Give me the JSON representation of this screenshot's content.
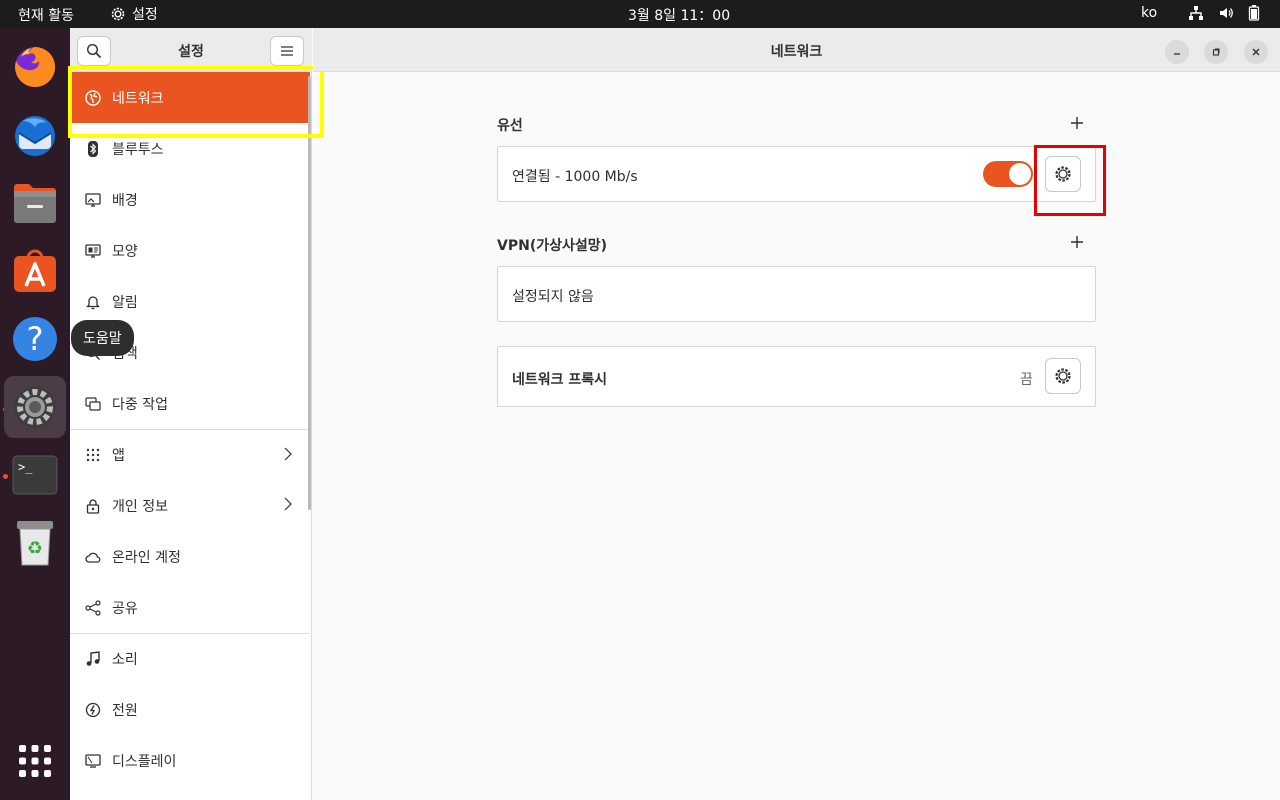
{
  "topbar": {
    "activities": "현재 활동",
    "app_name": "설정",
    "clock": "3월 8일  11：00",
    "lang": "ko"
  },
  "dock": {
    "tooltip": "도움말",
    "items": [
      "firefox-icon",
      "thunderbird-icon",
      "files-icon",
      "app-center-icon",
      "help-icon",
      "settings-icon",
      "terminal-icon",
      "trash-icon",
      "show-apps-icon"
    ]
  },
  "sidebar": {
    "title": "설정",
    "items": [
      {
        "label": "네트워크",
        "icon": "network-icon"
      },
      {
        "label": "블루투스",
        "icon": "bluetooth-icon"
      },
      {
        "label": "배경",
        "icon": "background-icon"
      },
      {
        "label": "모양",
        "icon": "appearance-icon"
      },
      {
        "label": "알림",
        "icon": "bell-icon"
      },
      {
        "label": "검색",
        "icon": "search-icon"
      },
      {
        "label": "다중 작업",
        "icon": "multitasking-icon"
      },
      {
        "label": "앱",
        "icon": "apps-icon"
      },
      {
        "label": "개인 정보",
        "icon": "lock-icon"
      },
      {
        "label": "온라인 계정",
        "icon": "cloud-icon"
      },
      {
        "label": "공유",
        "icon": "share-icon"
      },
      {
        "label": "소리",
        "icon": "music-note-icon"
      },
      {
        "label": "전원",
        "icon": "power-icon"
      },
      {
        "label": "디스플레이",
        "icon": "display-icon"
      }
    ]
  },
  "main": {
    "title": "네트워크",
    "wired": {
      "label": "유선",
      "status": "연결됨 - 1000 Mb/s",
      "enabled": true
    },
    "vpn": {
      "label": "VPN(가상사설망)",
      "status": "설정되지 않음"
    },
    "proxy": {
      "label": "네트워크 프록시",
      "status": "끔"
    }
  },
  "colors": {
    "accent": "#e95420",
    "annotation_yellow": "#ffff00",
    "annotation_red": "#e60000"
  }
}
